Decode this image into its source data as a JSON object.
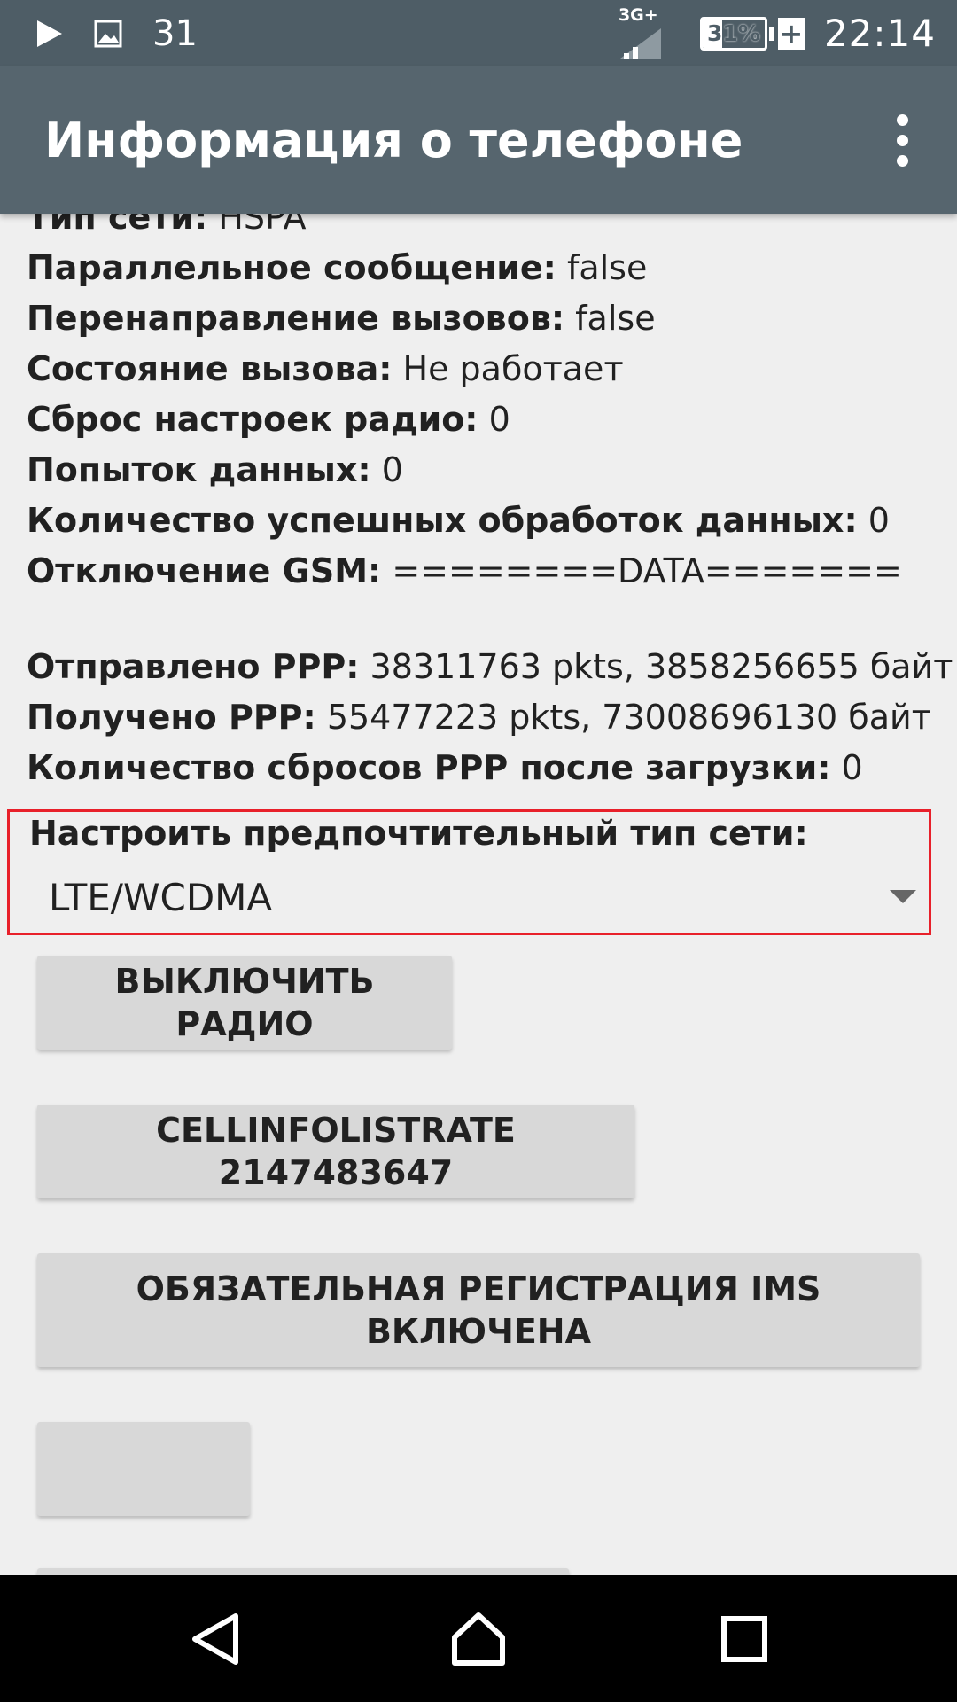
{
  "status_bar": {
    "notification_count": "31",
    "network_type": "3G+",
    "battery_percent": "31%",
    "battery_level": 0.31,
    "battery_charging_symbol": "+",
    "clock": "22:14",
    "icons": [
      "play-icon",
      "image-icon",
      "signal-icon",
      "battery-icon"
    ]
  },
  "app_bar": {
    "title": "Информация о телефоне",
    "overflow_icon": "more-vert-icon"
  },
  "info_rows": [
    {
      "label": "Тип сети:",
      "value": "HSPA"
    },
    {
      "label": "Параллельное сообщение:",
      "value": "false"
    },
    {
      "label": "Перенаправление вызовов:",
      "value": "false"
    },
    {
      "label": "Состояние вызова:",
      "value": "Не работает"
    },
    {
      "label": "Сброс настроек радио:",
      "value": "0"
    },
    {
      "label": "Попыток данных:",
      "value": "0"
    },
    {
      "label": "Количество успешных обработок данных:",
      "value": "0"
    },
    {
      "label": "Отключение GSM:",
      "value": "========DATA======="
    },
    {
      "label": "Отправлено PPP:",
      "value": "38311763 pkts, 3858256655 байт"
    },
    {
      "label": "Получено PPP:",
      "value": "55477223 pkts, 73008696130 байт"
    },
    {
      "label": "Количество сбросов PPP после загрузки:",
      "value": "0"
    }
  ],
  "preferred_network": {
    "label": "Настроить предпочтительный тип сети:",
    "selected": "LTE/WCDMA",
    "highlight_color": "#e8202a"
  },
  "buttons": {
    "radio_off": "ВЫКЛЮЧИТЬ РАДИО",
    "cellinfo_rate": "CELLINFOLISTRATE 2147483647",
    "ims_line1": "ОБЯЗАТЕЛЬНАЯ РЕГИСТРАЦИЯ IMS",
    "ims_line2": "ВКЛЮЧЕНА",
    "empty": ""
  },
  "nav_bar": {
    "icons": [
      "back-icon",
      "home-icon",
      "recents-icon"
    ]
  },
  "colors": {
    "status_bar": "#4e5d66",
    "app_bar": "#56656e",
    "background": "#efefef",
    "button": "#d8d8d8",
    "text": "#212121"
  }
}
